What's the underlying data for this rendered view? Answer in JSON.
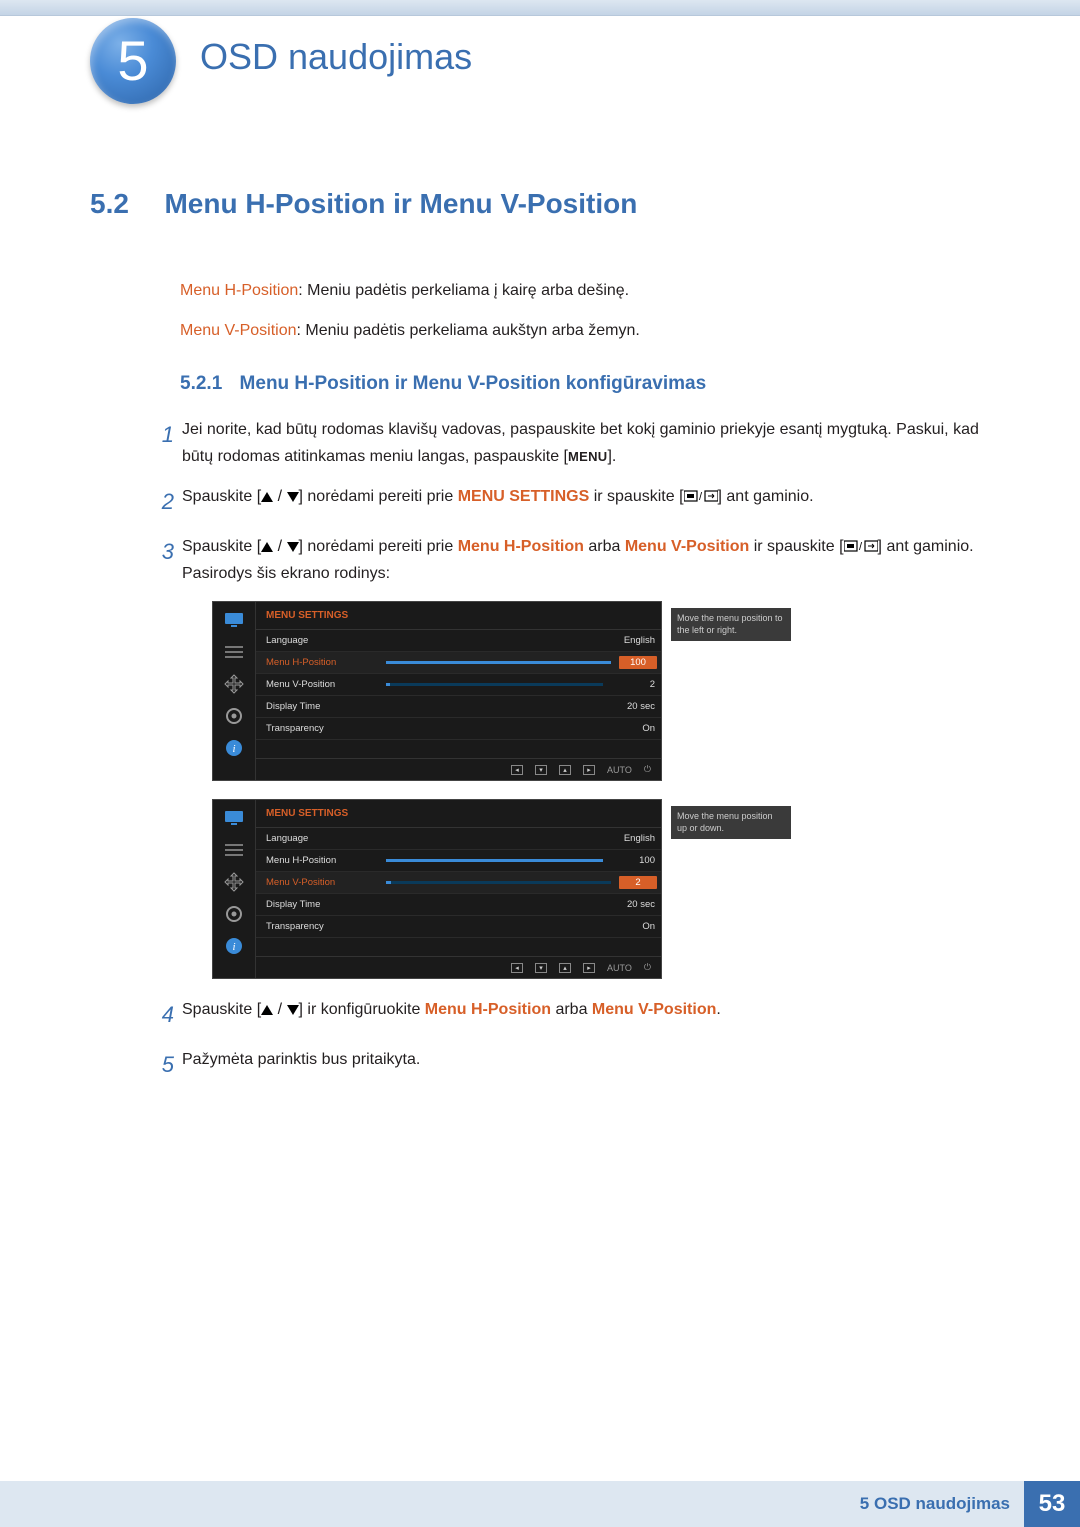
{
  "header": {
    "chapter_number": "5",
    "chapter_title": "OSD naudojimas"
  },
  "section": {
    "number": "5.2",
    "title": "Menu H-Position ir Menu V-Position"
  },
  "intro": {
    "hpos_label": "Menu H-Position",
    "hpos_desc": ": Meniu padėtis perkeliama į kairę arba dešinę.",
    "vpos_label": "Menu V-Position",
    "vpos_desc": ": Meniu padėtis perkeliama aukštyn arba žemyn."
  },
  "subsection": {
    "number": "5.2.1",
    "title": "Menu H-Position ir Menu V-Position konfigūravimas"
  },
  "steps": {
    "s1": {
      "num": "1",
      "text_a": "Jei norite, kad būtų rodomas klavišų vadovas, paspauskite bet kokį gaminio priekyje esantį mygtuką. Paskui, kad būtų rodomas atitinkamas meniu langas, paspauskite [",
      "text_b": "].",
      "menu_btn": "MENU"
    },
    "s2": {
      "num": "2",
      "text_a": "Spauskite [",
      "text_b": "] norėdami pereiti prie ",
      "accent": "MENU SETTINGS",
      "text_c": " ir spauskite [",
      "text_d": "] ant gaminio."
    },
    "s3": {
      "num": "3",
      "text_a": "Spauskite [",
      "text_b": "] norėdami pereiti prie ",
      "accent1": "Menu H-Position",
      "text_c": " arba ",
      "accent2": "Menu V-Position",
      "text_d": " ir spauskite [",
      "text_e": "] ant gaminio. Pasirodys šis ekrano rodinys:"
    },
    "s4": {
      "num": "4",
      "text_a": "Spauskite [",
      "text_b": "] ir konfigūruokite ",
      "accent1": "Menu H-Position",
      "text_c": " arba ",
      "accent2": "Menu V-Position",
      "text_d": "."
    },
    "s5": {
      "num": "5",
      "text": "Pažymėta parinktis bus pritaikyta."
    }
  },
  "osd1": {
    "title": "MENU SETTINGS",
    "tooltip": "Move the menu position to the left or right.",
    "auto": "AUTO",
    "items": {
      "language": {
        "label": "Language",
        "value": "English"
      },
      "hpos": {
        "label": "Menu H-Position",
        "value": "100"
      },
      "vpos": {
        "label": "Menu V-Position",
        "value": "2"
      },
      "dtime": {
        "label": "Display Time",
        "value": "20 sec"
      },
      "transp": {
        "label": "Transparency",
        "value": "On"
      }
    }
  },
  "osd2": {
    "title": "MENU SETTINGS",
    "tooltip": "Move the menu position up or down.",
    "auto": "AUTO",
    "items": {
      "language": {
        "label": "Language",
        "value": "English"
      },
      "hpos": {
        "label": "Menu H-Position",
        "value": "100"
      },
      "vpos": {
        "label": "Menu V-Position",
        "value": "2"
      },
      "dtime": {
        "label": "Display Time",
        "value": "20 sec"
      },
      "transp": {
        "label": "Transparency",
        "value": "On"
      }
    }
  },
  "footer": {
    "label": "5 OSD naudojimas",
    "page": "53"
  }
}
